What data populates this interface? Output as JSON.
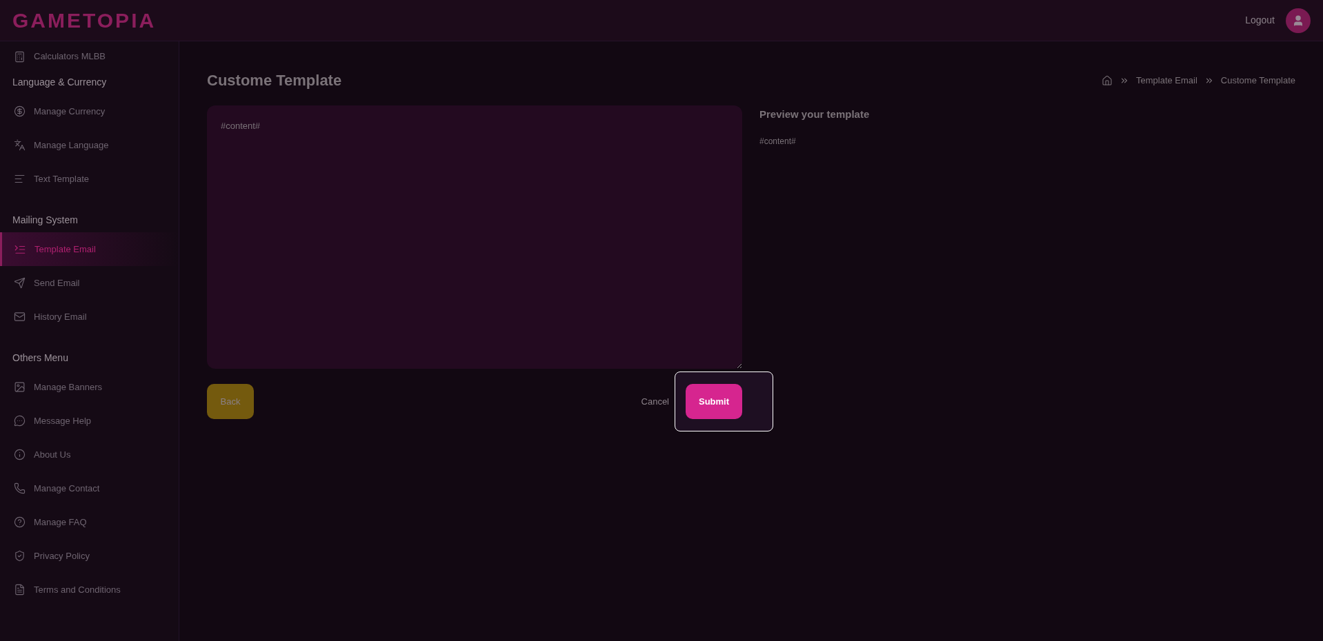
{
  "header": {
    "logo": "GAMETOPIA",
    "logout": "Logout"
  },
  "sidebar": {
    "sections": [
      {
        "items": [
          {
            "label": "Calculators MLBB",
            "selected": false
          }
        ]
      },
      {
        "title": "Language & Currency",
        "items": [
          {
            "label": "Manage Currency",
            "selected": false
          },
          {
            "label": "Manage Language",
            "selected": false
          },
          {
            "label": "Text Template",
            "selected": false
          }
        ]
      },
      {
        "title": "Mailing System",
        "items": [
          {
            "label": "Template Email",
            "selected": true
          },
          {
            "label": "Send Email",
            "selected": false
          },
          {
            "label": "History Email",
            "selected": false
          }
        ]
      },
      {
        "title": "Others Menu",
        "items": [
          {
            "label": "Manage Banners",
            "selected": false
          },
          {
            "label": "Message Help",
            "selected": false
          },
          {
            "label": "About Us",
            "selected": false
          },
          {
            "label": "Manage Contact",
            "selected": false
          },
          {
            "label": "Manage FAQ",
            "selected": false
          },
          {
            "label": "Privacy Policy",
            "selected": false
          },
          {
            "label": "Terms and Conditions",
            "selected": false
          }
        ]
      }
    ]
  },
  "page": {
    "title": "Custome Template",
    "breadcrumb": [
      "Template Email",
      "Custome Template"
    ]
  },
  "editor": {
    "value": "#content#"
  },
  "preview": {
    "title": "Preview your template",
    "content": "#content#"
  },
  "buttons": {
    "back": "Back",
    "cancel": "Cancel",
    "submit": "Submit"
  }
}
